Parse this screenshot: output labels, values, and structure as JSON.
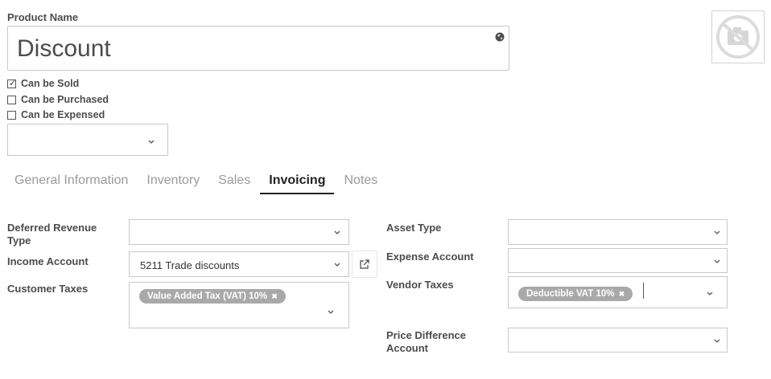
{
  "product": {
    "name_label": "Product Name",
    "name_value": "Discount",
    "globe_icon": "globe-icon",
    "image_icon": "no-camera-icon"
  },
  "checkboxes": [
    {
      "label": "Can be Sold",
      "checked": true
    },
    {
      "label": "Can be Purchased",
      "checked": false
    },
    {
      "label": "Can be Expensed",
      "checked": false
    }
  ],
  "product_type": {
    "value": ""
  },
  "tabs": [
    {
      "label": "General Information",
      "active": false
    },
    {
      "label": "Inventory",
      "active": false
    },
    {
      "label": "Sales",
      "active": false
    },
    {
      "label": "Invoicing",
      "active": true
    },
    {
      "label": "Notes",
      "active": false
    }
  ],
  "invoicing": {
    "left": {
      "deferred_revenue_type": {
        "label": "Deferred Revenue Type",
        "value": ""
      },
      "income_account": {
        "label": "Income Account",
        "value": "5211 Trade discounts"
      },
      "customer_taxes": {
        "label": "Customer Taxes",
        "tags": [
          "Value Added Tax (VAT) 10%"
        ]
      }
    },
    "right": {
      "asset_type": {
        "label": "Asset Type",
        "value": ""
      },
      "expense_account": {
        "label": "Expense Account",
        "value": ""
      },
      "vendor_taxes": {
        "label": "Vendor Taxes",
        "tags": [
          "Deductible VAT 10%"
        ]
      },
      "price_difference_account": {
        "label": "Price Difference Account",
        "value": ""
      }
    }
  },
  "tag_remove_glyph": "✖",
  "colors": {
    "tag_bg": "#a9a9a9",
    "border": "#c9c9c9",
    "active_tab": "#222222",
    "inactive_tab": "#9a9a9a"
  }
}
